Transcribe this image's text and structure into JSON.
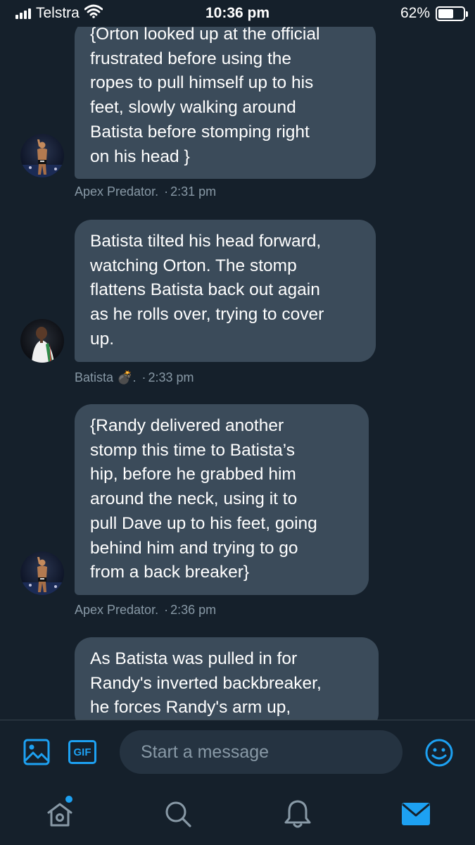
{
  "status_bar": {
    "carrier": "Telstra",
    "time": "10:36 pm",
    "battery_percent": "62%",
    "battery_level": 0.62
  },
  "messages": [
    {
      "text": "{Orton looked up at the official\nfrustrated before using the\nropes to pull himself up to his\nfeet, slowly walking around\nBatista before stomping right\non his head }",
      "sender": "Apex Predator.",
      "time": "2:31 pm",
      "avatar": "orton-avatar"
    },
    {
      "text": "Batista tilted his head forward,\nwatching Orton. The stomp\nflattens Batista back out again\nas he rolls over, trying to cover\nup.",
      "sender": "Batista 💣.",
      "time": "2:33 pm",
      "avatar": "batista-avatar"
    },
    {
      "text": "{Randy delivered another\nstomp this time to Batista’s\nhip, before he grabbed him\naround the neck, using it to\npull Dave up to his feet, going\nbehind him and trying to go\nfrom a back breaker}",
      "sender": "Apex Predator.",
      "time": "2:36 pm",
      "avatar": "orton-avatar"
    },
    {
      "text": "As Batista was pulled in for\nRandy's inverted backbreaker,\nhe forces Randy's arm up,"
    }
  ],
  "meta_separator": "·",
  "composer": {
    "gif_label": "GIF",
    "placeholder": "Start a message"
  },
  "colors": {
    "background": "#15202b",
    "bubble": "#3b4b5a",
    "accent": "#1da1f2",
    "muted_text": "#8899a6"
  },
  "icons": {
    "media": "image-icon",
    "gif": "gif-icon",
    "emoji": "smiley-icon",
    "home": "home-icon",
    "search": "search-icon",
    "notifications": "bell-icon",
    "messages": "mail-icon"
  }
}
